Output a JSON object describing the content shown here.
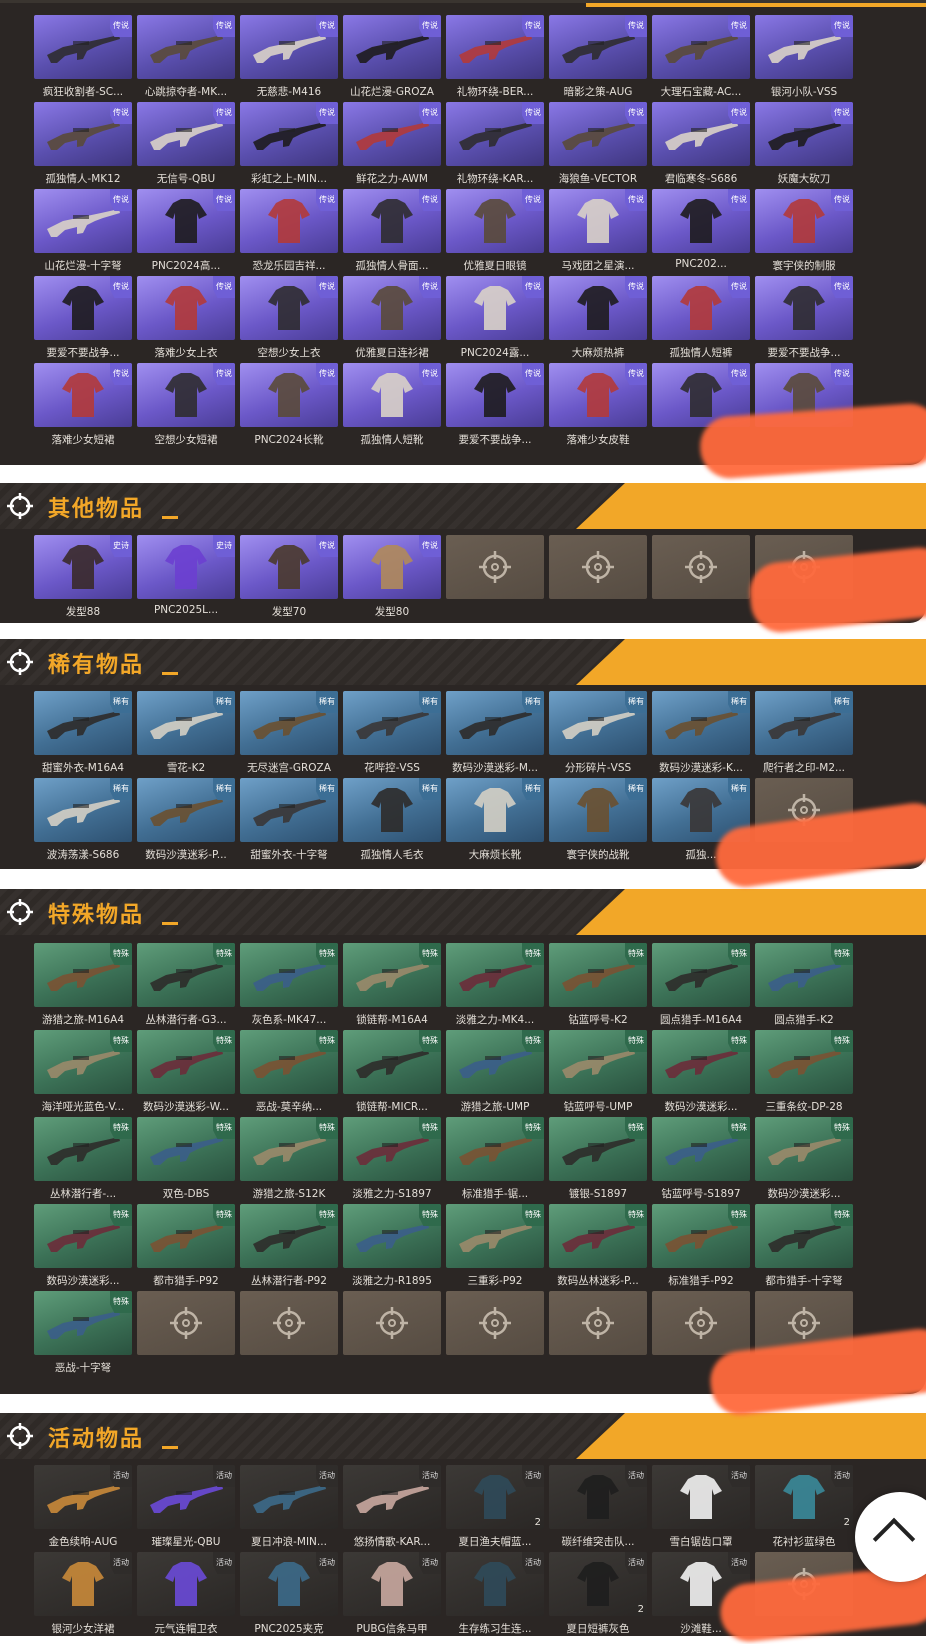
{
  "colors": {
    "accent": "#f2a728",
    "panel": "#2b2624",
    "legend": "#6f5fd6",
    "rare": "#3c6e95",
    "special": "#2f6a4c",
    "blur": "#ff6a3d"
  },
  "tags": {
    "legend": "传说",
    "epic": "史诗",
    "rare": "稀有",
    "special": "特殊",
    "event": "活动"
  },
  "sections": {
    "other": {
      "title": "其他物品"
    },
    "rare": {
      "title": "稀有物品"
    },
    "special": {
      "title": "特殊物品"
    },
    "event": {
      "title": "活动物品"
    }
  },
  "legend_items": [
    [
      "疯狂收割者-SC...",
      "心跳掠夺者-MK...",
      "无慈悲-M416",
      "山花烂漫-GROZA",
      "礼物环绕-BER...",
      "暗影之策-AUG",
      "大理石宝藏-AC...",
      "银河小队-VSS"
    ],
    [
      "孤独情人-MK12",
      "无信号-QBU",
      "彩虹之上-MIN...",
      "鲜花之力-AWM",
      "礼物环绕-KAR...",
      "海狼鱼-VECTOR",
      "君临寒冬-S686",
      "妖魔大砍刀"
    ],
    [
      "山花烂漫-十字弩",
      "PNC2024高...",
      "恐龙乐园吉祥...",
      "孤独情人骨面...",
      "优雅夏日眼镜",
      "马戏团之星演...",
      "PNC202...",
      "寰宇侠的制服"
    ],
    [
      "要爱不要战争...",
      "落难少女上衣",
      "空想少女上衣",
      "优雅夏日连衫裙",
      "PNC2024露...",
      "大麻烦热裤",
      "孤独情人短裤",
      "要爱不要战争..."
    ],
    [
      "落难少女短裙",
      "空想少女短裙",
      "PNC2024长靴",
      "孤独情人短靴",
      "要爱不要战争...",
      "落难少女皮鞋",
      "",
      ""
    ]
  ],
  "other_items": [
    "发型88",
    "PNC2025L...",
    "发型70",
    "发型80"
  ],
  "rare_items": [
    [
      "甜蜜外衣-M16A4",
      "雪花-K2",
      "无尽迷宫-GROZA",
      "花哔控-VSS",
      "数码沙漠迷彩-M...",
      "分形碎片-VSS",
      "数码沙漠迷彩-K...",
      "爬行者之印-M2..."
    ],
    [
      "波涛荡漾-S686",
      "数码沙漠迷彩-P...",
      "甜蜜外衣-十字弩",
      "孤独情人毛衣",
      "大麻烦长靴",
      "寰宇侠的战靴",
      "孤独...",
      ""
    ]
  ],
  "special_items": [
    [
      "游猎之旅-M16A4",
      "丛林潜行者-G3...",
      "灰色系-MK47...",
      "锁链帮-M16A4",
      "淡雅之力-MK4...",
      "钴蓝呼号-K2",
      "圆点猎手-M16A4",
      "圆点猎手-K2"
    ],
    [
      "海洋哑光蓝色-V...",
      "数码沙漠迷彩-W...",
      "恶战-莫辛纳...",
      "锁链帮-MICR...",
      "游猎之旅-UMP",
      "钴蓝呼号-UMP",
      "数码沙漠迷彩...",
      "三重条纹-DP-28"
    ],
    [
      "丛林潜行者-...",
      "双色-DBS",
      "游猎之旅-S12K",
      "淡雅之力-S1897",
      "标准猎手-锯...",
      "镀银-S1897",
      "钴蓝呼号-S1897",
      "数码沙漠迷彩..."
    ],
    [
      "数码沙漠迷彩...",
      "都市猎手-P92",
      "丛林潜行者-P92",
      "淡雅之力-R1895",
      "三重彩-P92",
      "数码丛林迷彩-P...",
      "标准猎手-P92",
      "都市猎手-十字弩"
    ],
    [
      "恶战-十字弩",
      "",
      "",
      "",
      "",
      "",
      "",
      ""
    ]
  ],
  "event_items": [
    [
      "金色续响-AUG",
      "璀璨星光-QBU",
      "夏日冲浪-MIN...",
      "悠扬情歌-KAR...",
      "夏日渔夫帽蓝...",
      "碳纤维突击队...",
      "雪白锯齿口罩",
      "花衬衫蓝绿色"
    ],
    [
      "银河少女洋裙",
      "元气连帽卫衣",
      "PNC2025夹克",
      "PUBG信条马甲",
      "生存练习生连...",
      "夏日短裤灰色",
      "沙滩鞋...",
      ""
    ]
  ],
  "event_counts": {
    "r0c4": "2",
    "r0c7": "2",
    "r1c5": "2"
  }
}
